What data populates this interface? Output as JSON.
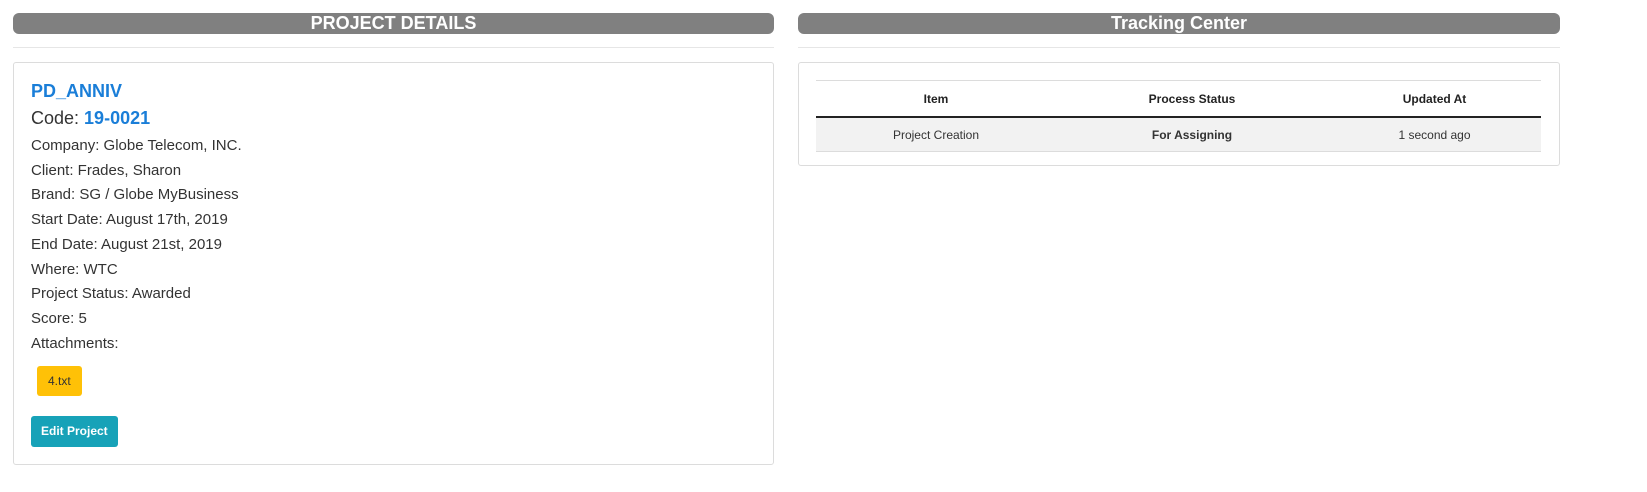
{
  "project_details": {
    "header": "PROJECT DETAILS",
    "name": "PD_ANNIV",
    "code_label": "Code: ",
    "code_value": "19-0021",
    "details": [
      "Company: Globe Telecom, INC.",
      "Client: Frades, Sharon",
      "Brand: SG / Globe MyBusiness",
      "Start Date: August 17th, 2019",
      "End Date: August 21st, 2019",
      "Where: WTC",
      "Project Status: Awarded",
      "Score: 5",
      "Attachments:"
    ],
    "attachment": "4.txt",
    "edit_button": "Edit Project"
  },
  "tracking": {
    "header": "Tracking Center",
    "columns": [
      "Item",
      "Process Status",
      "Updated At"
    ],
    "rows": [
      {
        "item": "Project Creation",
        "status": "For Assigning",
        "updated": "1 second ago"
      }
    ]
  },
  "colors": {
    "header_bg": "#808080",
    "link_blue": "#1a7ed8",
    "attachment_yellow": "#ffc107",
    "button_teal": "#17a2b8",
    "status_orange": "#e8a317"
  }
}
